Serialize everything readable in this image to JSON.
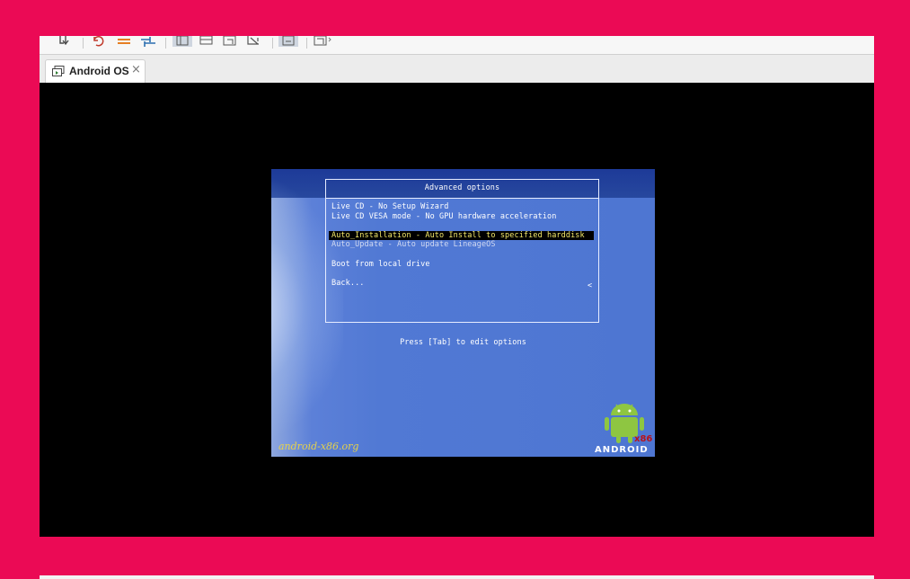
{
  "tab": {
    "label": "Android OS",
    "close": "×"
  },
  "toolbar": {
    "icons": [
      "download-icon",
      "undo-icon",
      "swap-icon",
      "settings-icon",
      "layout-icon",
      "window-icon",
      "fullscreen-icon",
      "scale-icon",
      "snapshot-icon",
      "clone-icon"
    ]
  },
  "grub": {
    "menu_title": "Advanced options",
    "items": [
      {
        "label": "Live CD - No Setup Wizard",
        "state": "normal"
      },
      {
        "label": "Live CD VESA mode - No GPU hardware acceleration",
        "state": "normal"
      },
      {
        "label": "Auto_Installation - Auto Install to specified harddisk",
        "state": "selected"
      },
      {
        "label": "Auto_Update - Auto update LineageOS",
        "state": "dim"
      },
      {
        "label": "Boot from local drive",
        "state": "normal"
      },
      {
        "label": "Back...",
        "state": "normal"
      }
    ],
    "submenu_marker": "<",
    "hint": "Press [Tab] to edit options",
    "site": "android-x86.org",
    "wordmark": "ANDROID",
    "badge": "x86"
  },
  "colors": {
    "page_background": "#eb0a55",
    "grub_blue": "#5179d4",
    "grub_topbar": "#1d3a98",
    "selected_text": "#f3e86a",
    "site_text": "#e6d24a",
    "android_green": "#8ec641"
  }
}
